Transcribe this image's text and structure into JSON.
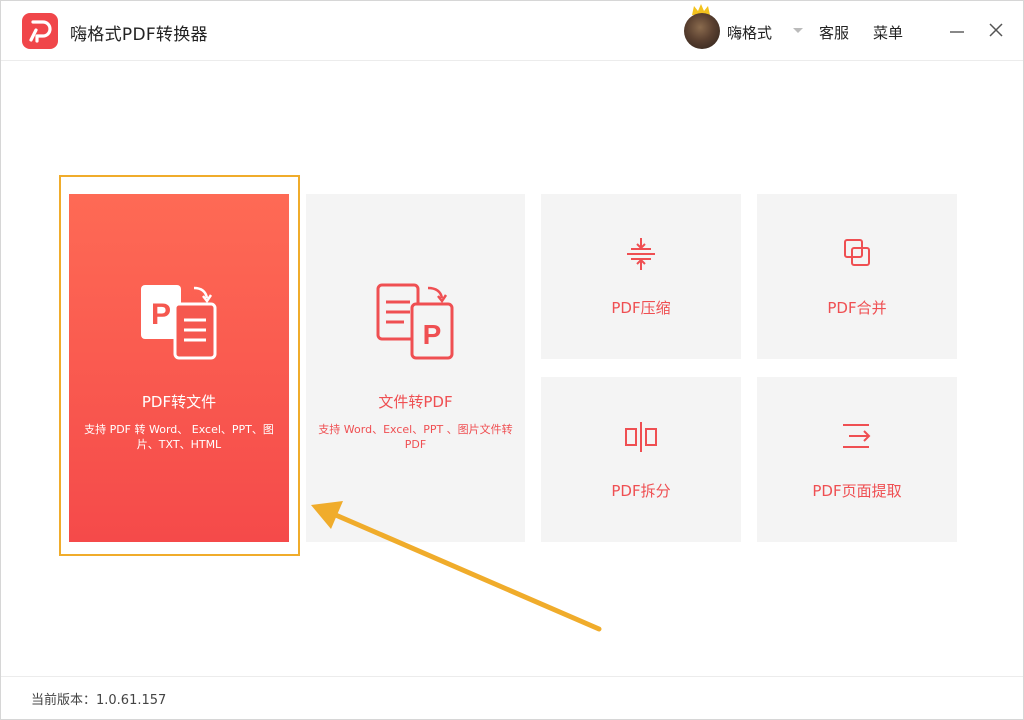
{
  "app": {
    "title": "嗨格式PDF转换器"
  },
  "header": {
    "username": "嗨格式",
    "service_label": "客服",
    "menu_label": "菜单"
  },
  "cards": {
    "pdf_to_file": {
      "title": "PDF转文件",
      "desc": "支持 PDF 转 Word、 Excel、PPT、图片、TXT、HTML"
    },
    "file_to_pdf": {
      "title": "文件转PDF",
      "desc": "支持 Word、Excel、PPT 、图片文件转 PDF"
    },
    "compress": {
      "title": "PDF压缩"
    },
    "merge": {
      "title": "PDF合并"
    },
    "split": {
      "title": "PDF拆分"
    },
    "extract": {
      "title": "PDF页面提取"
    }
  },
  "footer": {
    "version": "当前版本：1.0.61.157"
  },
  "colors": {
    "accent": "#f0464a",
    "highlight_frame": "#f0ac2b",
    "arrow": "#f0ac2b",
    "card_bg": "#f4f4f4"
  },
  "icons": [
    "app-logo-icon",
    "crown-icon",
    "chevron-down-icon",
    "minimize-icon",
    "close-icon",
    "pdf-to-file-icon",
    "file-to-pdf-icon",
    "compress-icon",
    "merge-icon",
    "split-icon",
    "extract-icon"
  ]
}
